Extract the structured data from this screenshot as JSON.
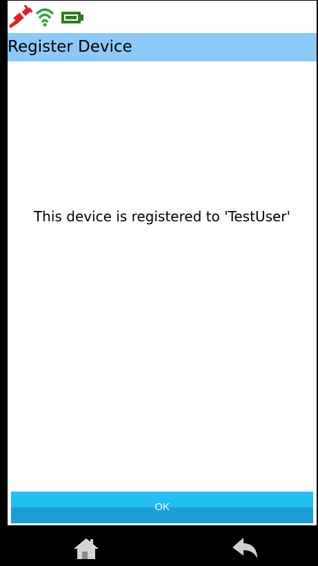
{
  "status_bar": {
    "icons": [
      "plug-disconnected-icon",
      "wifi-icon",
      "battery-icon"
    ],
    "colors": {
      "plug": "#d9232a",
      "wifi": "#2ea43a",
      "battery": "#2f7d1f"
    }
  },
  "header": {
    "title": "Register Device",
    "background": "#8cc9f9"
  },
  "main": {
    "message": "This device is registered to 'TestUser'"
  },
  "actions": {
    "ok_label": "OK",
    "ok_color": "#22bdf0"
  },
  "nav": {
    "icons": [
      "home-icon",
      "back-icon"
    ]
  }
}
